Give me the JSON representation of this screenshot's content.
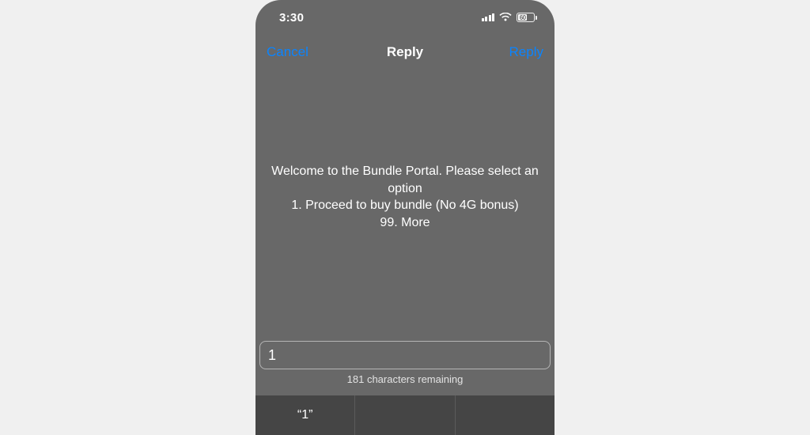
{
  "status": {
    "time": "3:30",
    "battery_pct": "60"
  },
  "nav": {
    "cancel": "Cancel",
    "title": "Reply",
    "reply": "Reply"
  },
  "ussd": {
    "line1": "Welcome to the Bundle Portal. Please select an option",
    "line2": "1.  Proceed to buy bundle (No 4G bonus)",
    "line3": "99. More"
  },
  "input": {
    "value": "1",
    "remaining": "181 characters remaining"
  },
  "keyboard": {
    "suggestion1": "“1”"
  }
}
